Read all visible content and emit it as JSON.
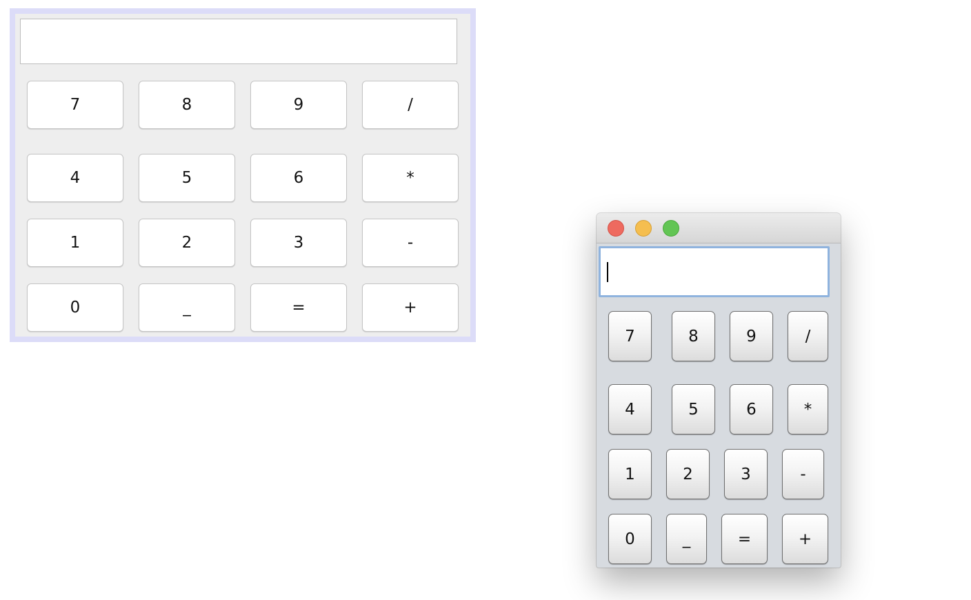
{
  "designer_preview": {
    "display_value": "",
    "buttons": [
      "7",
      "8",
      "9",
      "/",
      "4",
      "5",
      "6",
      "*",
      "1",
      "2",
      "3",
      "-",
      "0",
      "_",
      "=",
      "+"
    ]
  },
  "app_window": {
    "traffic_lights": [
      "close-icon",
      "minimize-icon",
      "maximize-icon"
    ],
    "display_value": "",
    "buttons": [
      "7",
      "8",
      "9",
      "/",
      "4",
      "5",
      "6",
      "*",
      "1",
      "2",
      "3",
      "-",
      "0",
      "_",
      "=",
      "+"
    ]
  },
  "colors": {
    "designer_border": "#dcdcf8",
    "designer_panel": "#eeeeee",
    "window_body": "#d7dbe0",
    "focus_ring": "#8fb3de"
  }
}
